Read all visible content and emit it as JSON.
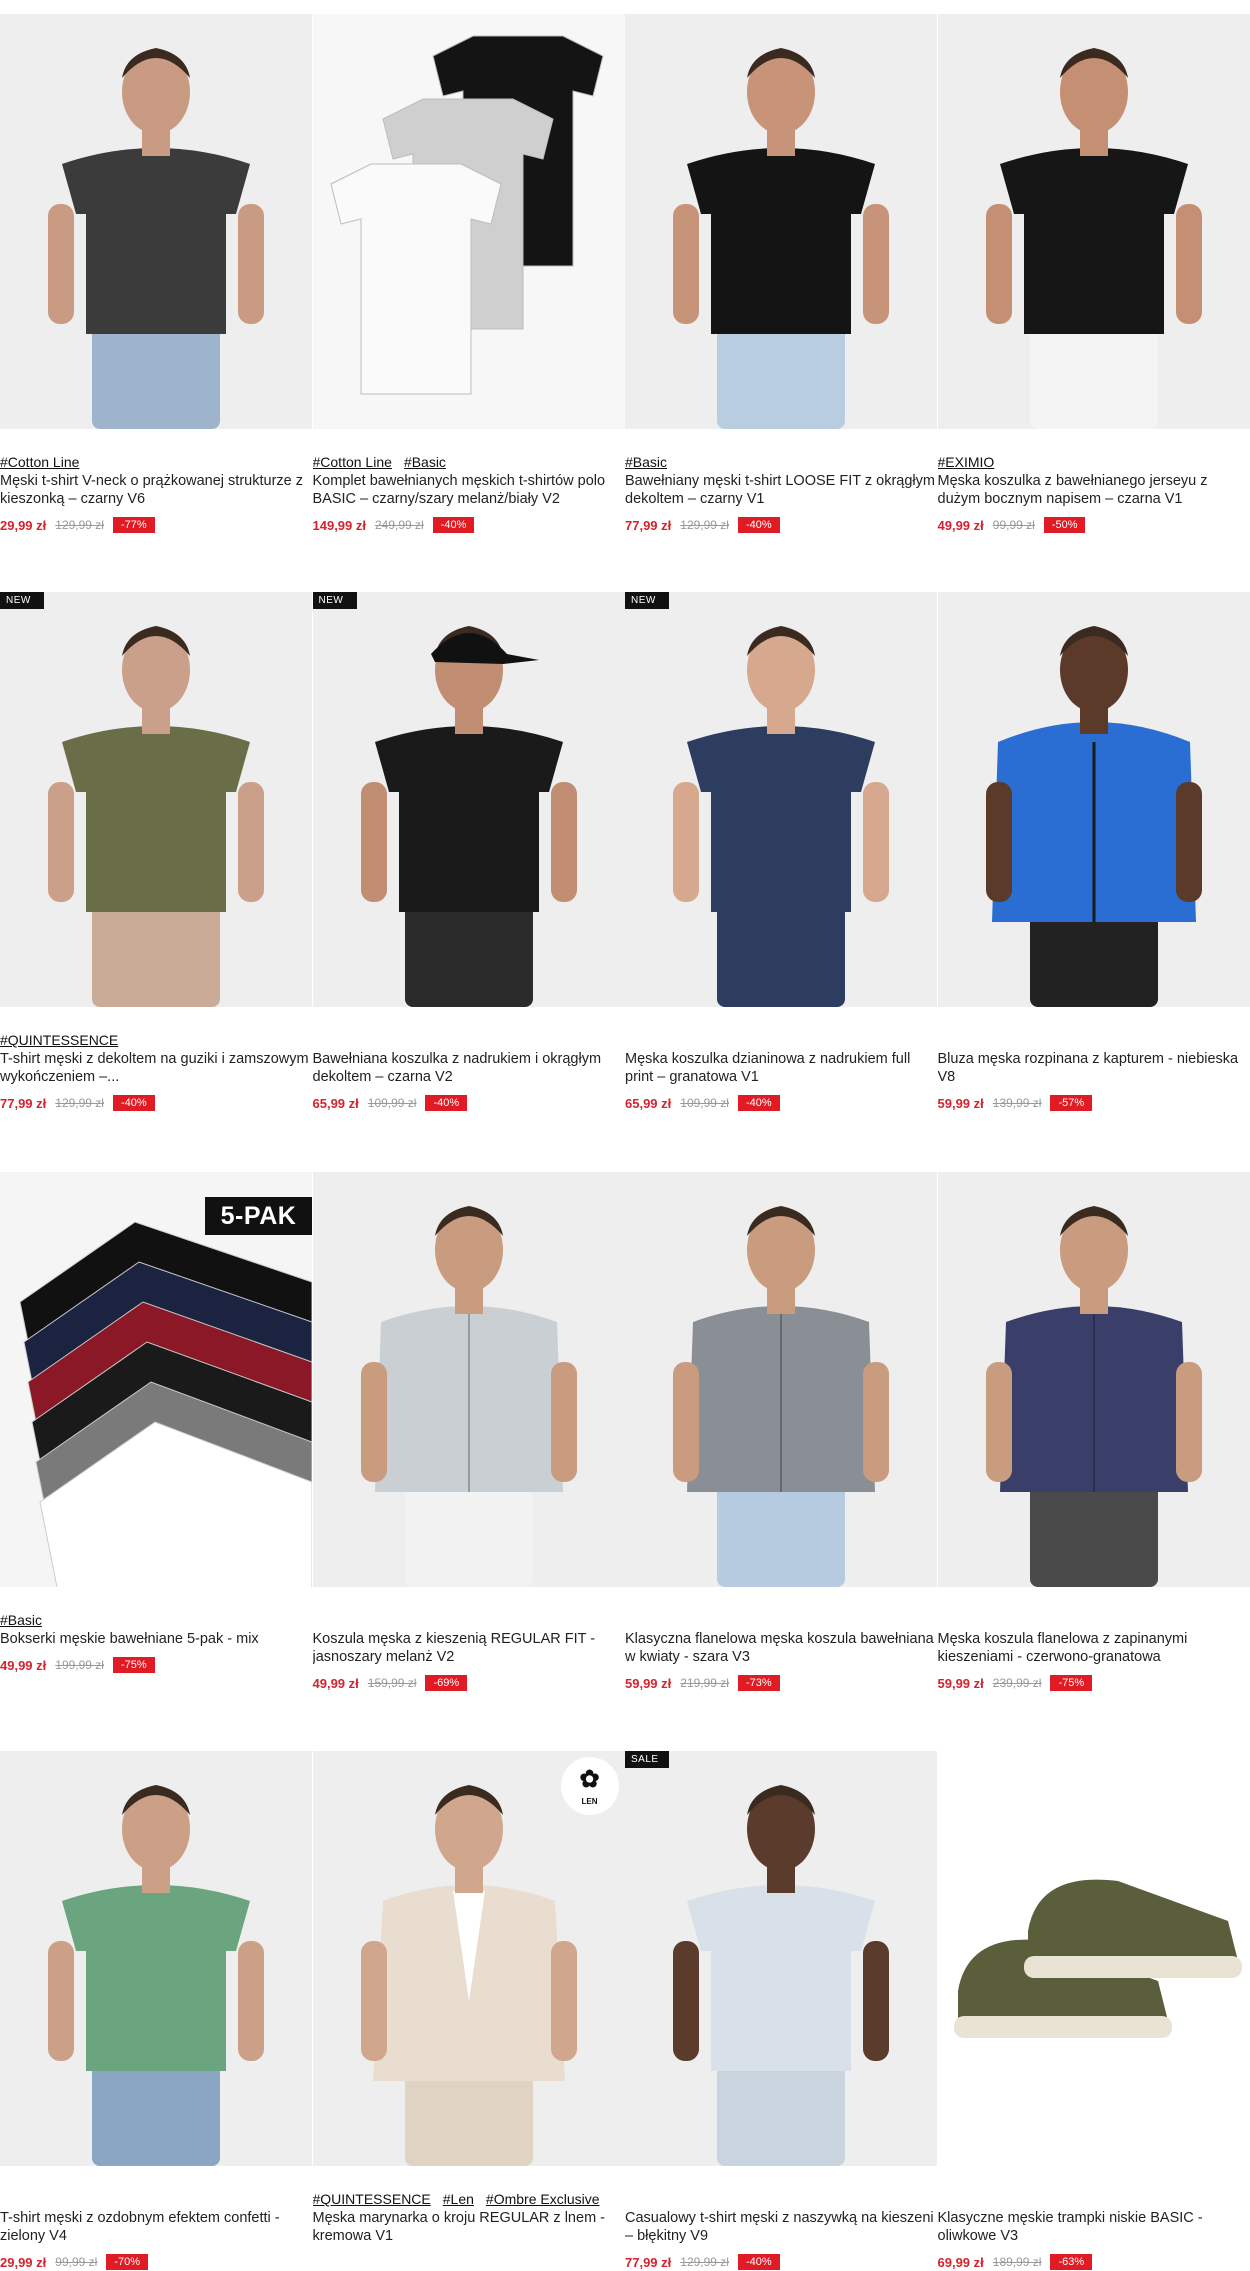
{
  "products": [
    {
      "tags": [
        "#Cotton Line"
      ],
      "name": "Męski t-shirt V-neck o prążkowanej strukturze z kieszonką – czarny V6",
      "price": "29,99 zł",
      "old_price": "129,99 zł",
      "discount": "-77%",
      "badge": ""
    },
    {
      "tags": [
        "#Cotton Line",
        "#Basic"
      ],
      "name": "Komplet bawełnianych męskich t-shirtów polo BASIC – czarny/szary melanż/biały V2",
      "price": "149,99 zł",
      "old_price": "249,99 zł",
      "discount": "-40%",
      "badge": ""
    },
    {
      "tags": [
        "#Basic"
      ],
      "name": "Bawełniany męski t-shirt LOOSE FIT z okrągłym dekoltem – czarny V1",
      "price": "77,99 zł",
      "old_price": "129,99 zł",
      "discount": "-40%",
      "badge": ""
    },
    {
      "tags": [
        "#EXIMIO"
      ],
      "name": "Męska koszulka z bawełnianego jerseyu z dużym bocznym napisem – czarna V1",
      "price": "49,99 zł",
      "old_price": "99,99 zł",
      "discount": "-50%",
      "badge": ""
    },
    {
      "tags": [
        "#QUINTESSENCE"
      ],
      "name": "T-shirt męski z dekoltem na guziki i zamszowym wykończeniem –...",
      "price": "77,99 zł",
      "old_price": "129,99 zł",
      "discount": "-40%",
      "badge": "NEW"
    },
    {
      "tags": [],
      "name": "Bawełniana koszulka z nadrukiem i okrągłym dekoltem – czarna V2",
      "price": "65,99 zł",
      "old_price": "109,99 zł",
      "discount": "-40%",
      "badge": "NEW"
    },
    {
      "tags": [],
      "name": "Męska koszulka dzianinowa z nadrukiem full print – granatowa V1",
      "price": "65,99 zł",
      "old_price": "109,99 zł",
      "discount": "-40%",
      "badge": "NEW"
    },
    {
      "tags": [],
      "name": "Bluza męska rozpinana z kapturem - niebieska V8",
      "price": "59,99 zł",
      "old_price": "139,99 zł",
      "discount": "-57%",
      "badge": ""
    },
    {
      "tags": [
        "#Basic"
      ],
      "name": "Bokserki męskie bawełniane 5-pak - mix",
      "price": "49,99 zł",
      "old_price": "199,99 zł",
      "discount": "-75%",
      "badge": "",
      "pack": "5-PAK"
    },
    {
      "tags": [],
      "name": "Koszula męska z kieszenią REGULAR FIT - jasnoszary melanż V2",
      "price": "49,99 zł",
      "old_price": "159,99 zł",
      "discount": "-69%",
      "badge": ""
    },
    {
      "tags": [],
      "name": "Klasyczna flanelowa męska koszula bawełniana w kwiaty - szara V3",
      "price": "59,99 zł",
      "old_price": "219,99 zł",
      "discount": "-73%",
      "badge": ""
    },
    {
      "tags": [],
      "name": "Męska koszula flanelowa z zapinanymi kieszeniami - czerwono-granatowa",
      "price": "59,99 zł",
      "old_price": "239,99 zł",
      "discount": "-75%",
      "badge": ""
    },
    {
      "tags": [],
      "name": "T-shirt męski z ozdobnym efektem confetti - zielony V4",
      "price": "29,99 zł",
      "old_price": "99,99 zł",
      "discount": "-70%",
      "badge": ""
    },
    {
      "tags": [
        "#QUINTESSENCE",
        "#Len",
        "#Ombre Exclusive"
      ],
      "name": "Męska marynarka o kroju REGULAR z lnem - kremowa V1",
      "price": "",
      "old_price": "",
      "discount": "",
      "badge": "",
      "len_badge": "LEN"
    },
    {
      "tags": [],
      "name": "Casualowy t-shirt męski z naszywką na kieszeni – błękitny V9",
      "price": "77,99 zł",
      "old_price": "129,99 zł",
      "discount": "-40%",
      "badge": "SALE"
    },
    {
      "tags": [],
      "name": "Klasyczne męskie trampki niskie BASIC - oliwkowe V3",
      "price": "69,99 zł",
      "old_price": "189,99 zł",
      "discount": "-63%",
      "badge": ""
    }
  ],
  "colors": {
    "price": "#d3232f",
    "discount_bg": "#e11b24"
  },
  "illustrations": [
    {
      "kind": "person",
      "garment": "tshirt",
      "shirt": "#3b3b3b",
      "pants": "#9db4cc",
      "skin": "#c89b82"
    },
    {
      "kind": "polos"
    },
    {
      "kind": "person",
      "garment": "tshirt",
      "shirt": "#141414",
      "pants": "#b9cde0",
      "skin": "#c79479"
    },
    {
      "kind": "person",
      "garment": "tshirt",
      "shirt": "#161616",
      "pants": "#f4f4f4",
      "skin": "#c58f74"
    },
    {
      "kind": "person",
      "garment": "tshirt",
      "shirt": "#6a6e48",
      "pants": "#c9ab98",
      "skin": "#caa08a"
    },
    {
      "kind": "person",
      "garment": "tshirt",
      "shirt": "#1a1a1a",
      "pants": "#2b2b2b",
      "skin": "#c18d73",
      "cap": "#111111"
    },
    {
      "kind": "person",
      "garment": "tshirt",
      "shirt": "#2c3d5f",
      "pants": "#2c3d5f",
      "skin": "#d6a88e"
    },
    {
      "kind": "person",
      "garment": "hoodie",
      "shirt": "#2a6ed3",
      "pants": "#222222",
      "skin": "#5b3a2a"
    },
    {
      "kind": "boxers"
    },
    {
      "kind": "person",
      "garment": "shirt",
      "shirt": "#c9cfd3",
      "pants": "#f2f2f2",
      "skin": "#c99b7f"
    },
    {
      "kind": "person",
      "garment": "shirt",
      "shirt": "#8a8f95",
      "pants": "#b6cbe0",
      "skin": "#c99b7f"
    },
    {
      "kind": "person",
      "garment": "shirt",
      "shirt": "#3a3f6a",
      "pants": "#4a4a4a",
      "skin": "#c99b7f"
    },
    {
      "kind": "person",
      "garment": "tshirt",
      "shirt": "#6aa57f",
      "pants": "#8ba6c2",
      "skin": "#cca087"
    },
    {
      "kind": "person",
      "garment": "blazer",
      "shirt": "#e8ddce",
      "pants": "#dfd3c3",
      "skin": "#d0a68c"
    },
    {
      "kind": "person",
      "garment": "tshirt",
      "shirt": "#d8e0e9",
      "pants": "#c9d4de",
      "skin": "#5a3b2c"
    },
    {
      "kind": "sneakers"
    }
  ]
}
